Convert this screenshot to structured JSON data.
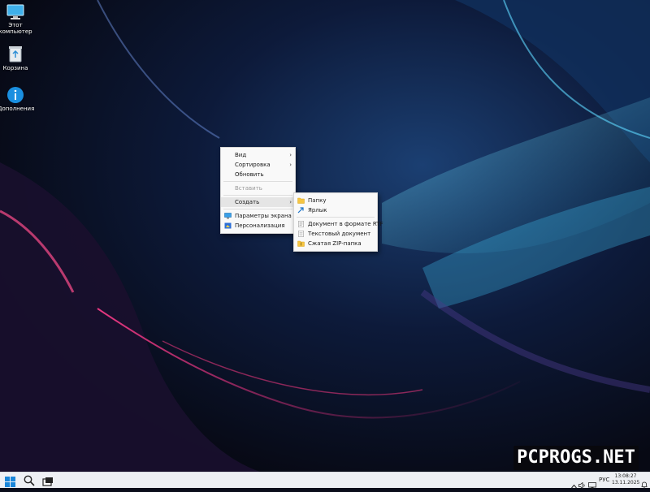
{
  "desktop": {
    "icons": [
      {
        "label": "Этот компьютер",
        "icon": "monitor-icon"
      },
      {
        "label": "Корзина",
        "icon": "recycle-bin-icon"
      },
      {
        "label": "Дополнения",
        "icon": "info-icon"
      }
    ]
  },
  "context_menu": {
    "items": {
      "view": "Вид",
      "sort": "Сортировка",
      "refresh": "Обновить",
      "paste": "Вставить",
      "create": "Создать",
      "display_settings": "Параметры экрана",
      "personalization": "Персонализация"
    }
  },
  "submenu": {
    "items": {
      "folder": "Папку",
      "shortcut": "Ярлык",
      "rtf_document": "Документ в формате RTF",
      "text_document": "Текстовый документ",
      "zip_folder": "Сжатая ZIP-папка"
    }
  },
  "taskbar": {
    "language": "РУС",
    "time": "13:08:27",
    "date": "13.11.2025"
  },
  "watermark": "PCPROGS.NET",
  "colors": {
    "accent": "#0078d4",
    "folder": "#f5c542",
    "menu_bg": "#f9f9f9",
    "highlight": "#e5e5e5"
  }
}
